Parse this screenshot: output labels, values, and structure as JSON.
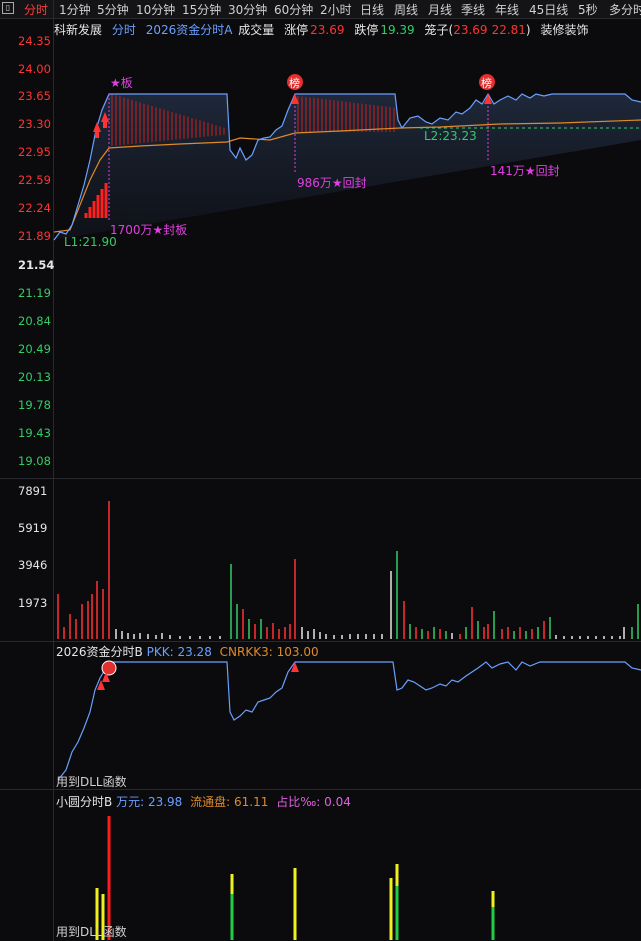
{
  "tabs": [
    "分时",
    "1分钟",
    "5分钟",
    "10分钟",
    "15分钟",
    "30分钟",
    "60分钟",
    "2小时",
    "日线",
    "周线",
    "月线",
    "季线",
    "年线",
    "45日线",
    "5秒",
    "多分时"
  ],
  "header": {
    "stock": "科新发展",
    "mode": "分时",
    "indicator": "2026资金分时A",
    "volume_label": "成交量",
    "limit_up_label": "涨停",
    "limit_up": "23.69",
    "limit_down_label": "跌停",
    "limit_down": "19.39",
    "cage_label": "笼子(",
    "cage_high": "23.69",
    "cage_low": "22.81",
    "cage_close": ")",
    "sector": "装修装饰"
  },
  "price_axis": {
    "up": [
      "24.35",
      "24.00",
      "23.65",
      "23.30",
      "22.95",
      "22.59",
      "22.24",
      "21.89"
    ],
    "mid": "21.54",
    "down": [
      "21.19",
      "20.84",
      "20.49",
      "20.13",
      "19.78",
      "19.43",
      "19.08"
    ]
  },
  "vol_axis": [
    "7891",
    "5919",
    "3946",
    "1973"
  ],
  "annotations": {
    "board": "★板",
    "bang": "榜",
    "seal1": "1700万★封板",
    "seal2": "986万★回封",
    "seal3": "141万★回封",
    "l1": "L1:21.90",
    "l2": "L2:23.23"
  },
  "panel_b": {
    "title": "2026资金分时B",
    "pkk_label": "PKK:",
    "pkk": "23.28",
    "cnrkk_label": "CNRKK3:",
    "cnrkk": "103.00",
    "footer": "用到DLL函数"
  },
  "panel_c": {
    "title": "小圆分时B",
    "wan_label": "万元:",
    "wan": "23.98",
    "float_label": "流通盘:",
    "float": "61.11",
    "ratio_label": "占比‰:",
    "ratio": "0.04",
    "footer": "用到DLL函数"
  },
  "colors": {
    "up": "#ff3333",
    "down": "#33cc66",
    "price_line": "#6aa0ff",
    "avg_line": "#e08a2a",
    "magenta": "#e040e0",
    "yellow": "#f0f020"
  }
}
